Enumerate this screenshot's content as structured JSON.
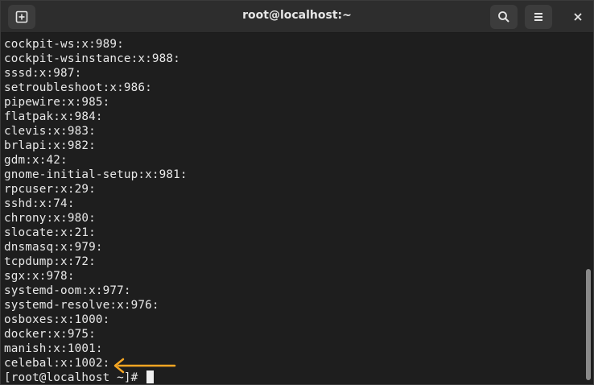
{
  "window": {
    "title": "root@localhost:~"
  },
  "terminal": {
    "lines": [
      "cockpit-ws:x:989:",
      "cockpit-wsinstance:x:988:",
      "sssd:x:987:",
      "setroubleshoot:x:986:",
      "pipewire:x:985:",
      "flatpak:x:984:",
      "clevis:x:983:",
      "brlapi:x:982:",
      "gdm:x:42:",
      "gnome-initial-setup:x:981:",
      "rpcuser:x:29:",
      "sshd:x:74:",
      "chrony:x:980:",
      "slocate:x:21:",
      "dnsmasq:x:979:",
      "tcpdump:x:72:",
      "sgx:x:978:",
      "systemd-oom:x:977:",
      "systemd-resolve:x:976:",
      "osboxes:x:1000:",
      "docker:x:975:",
      "manish:x:1001:",
      "celebal:x:1002:"
    ],
    "prompt": "[root@localhost ~]# "
  },
  "icons": {
    "new_tab": "new-tab-icon",
    "search": "search-icon",
    "menu": "hamburger-menu-icon",
    "close": "close-icon",
    "annotation": "arrow-left-icon"
  },
  "colors": {
    "terminal_bg": "#1e1e1e",
    "titlebar_bg": "#2d2d2d",
    "text": "#e8e8e8",
    "annotation_arrow": "#f5a623"
  }
}
